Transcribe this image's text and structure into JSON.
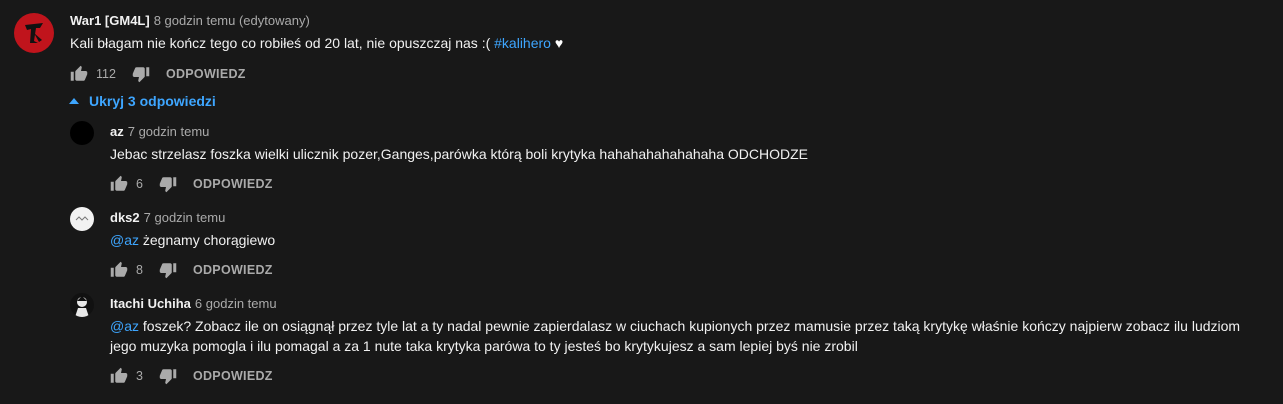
{
  "top_comment": {
    "author": "War1 [GM4L]",
    "time": "8 godzin temu (edytowany)",
    "text_before": "Kali błagam nie kończ tego co robiłeś od 20 lat, nie opuszczaj nas :( ",
    "hashtag": "#kalihero",
    "heart": "♥",
    "likes": "112",
    "reply_label": "ODPOWIEDZ"
  },
  "replies_toggle": {
    "label": "Ukryj 3 odpowiedzi"
  },
  "replies": [
    {
      "author": "az",
      "time": "7 godzin temu",
      "text": "Jebac strzelasz foszka wielki ulicznik pozer,Ganges,parówka którą boli krytyka hahahahahahahaha ODCHODZE",
      "likes": "6",
      "reply_label": "ODPOWIEDZ"
    },
    {
      "author": "dks2",
      "time": "7 godzin temu",
      "mention": "@az",
      "text": " żegnamy chorągiewo",
      "likes": "8",
      "reply_label": "ODPOWIEDZ"
    },
    {
      "author": "Itachi Uchiha",
      "time": "6 godzin temu",
      "mention": "@az",
      "text": " foszek? Zobacz ile on osiągnął przez tyle lat a ty nadal pewnie zapierdalasz w ciuchach kupionych przez mamusie przez taką krytykę właśnie kończy najpierw zobacz ilu ludziom jego muzyka pomogla i ilu pomagal a za 1 nute taka krytyka parówa to ty jesteś bo krytykujesz a sam lepiej byś nie zrobil",
      "likes": "3",
      "reply_label": "ODPOWIEDZ"
    }
  ],
  "colors": {
    "background": "#181818",
    "text": "#f1f1f1",
    "secondary": "#aaaaaa",
    "link": "#3ea6ff",
    "avatar_red": "#c0141c"
  },
  "icons": [
    "thumb-up-icon",
    "thumb-down-icon",
    "caret-up-icon",
    "heart-icon"
  ]
}
